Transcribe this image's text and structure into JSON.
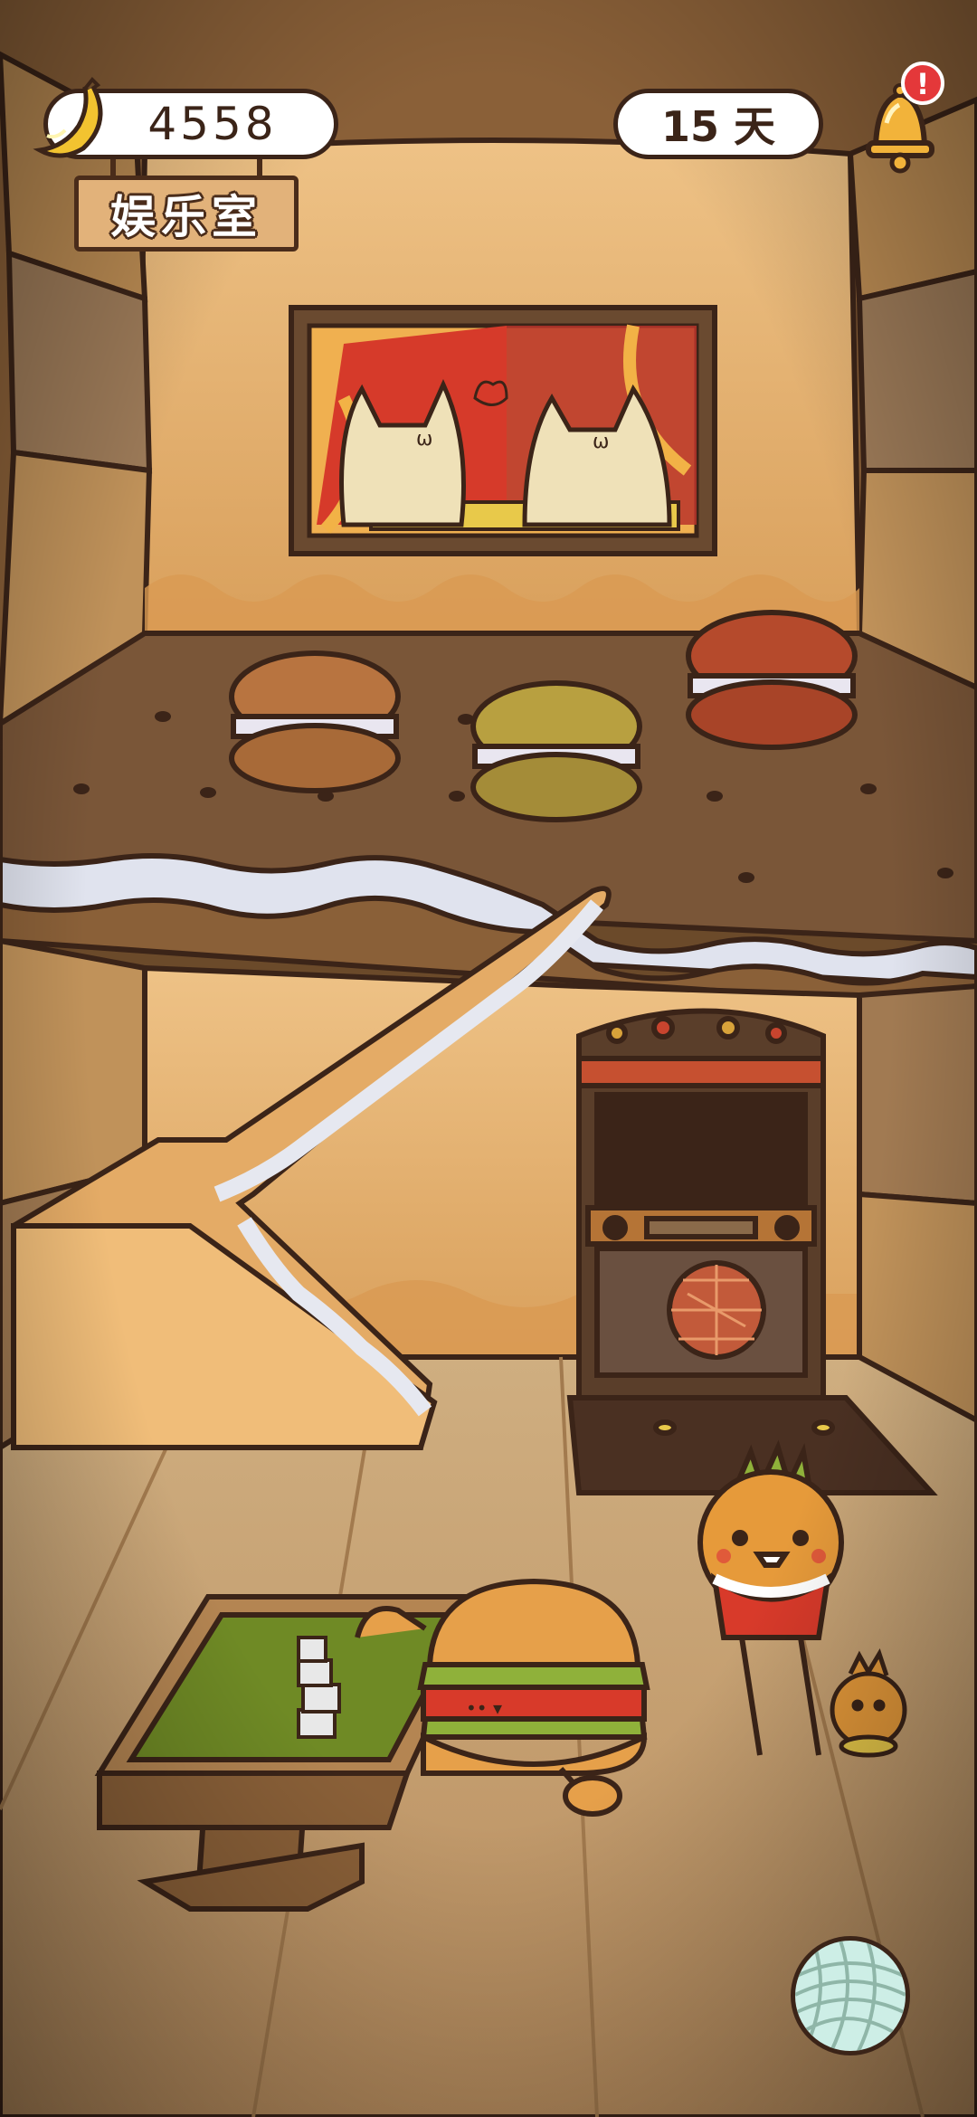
{
  "hud": {
    "banana_count": "4558",
    "days": "15 天",
    "room_name": "娱乐室",
    "notification_badge": "!"
  },
  "icons": {
    "currency": "banana-icon",
    "notifications": "bell-icon",
    "menu": "yarn-ball-icon"
  },
  "colors": {
    "wall": "#e9b878",
    "floor": "#c7a070",
    "dark_outline": "#3b2418",
    "badge_red": "#e4383a",
    "bell_gold": "#f2b33a",
    "table_felt": "#6f8a25",
    "yarn": "#cdeee6"
  }
}
